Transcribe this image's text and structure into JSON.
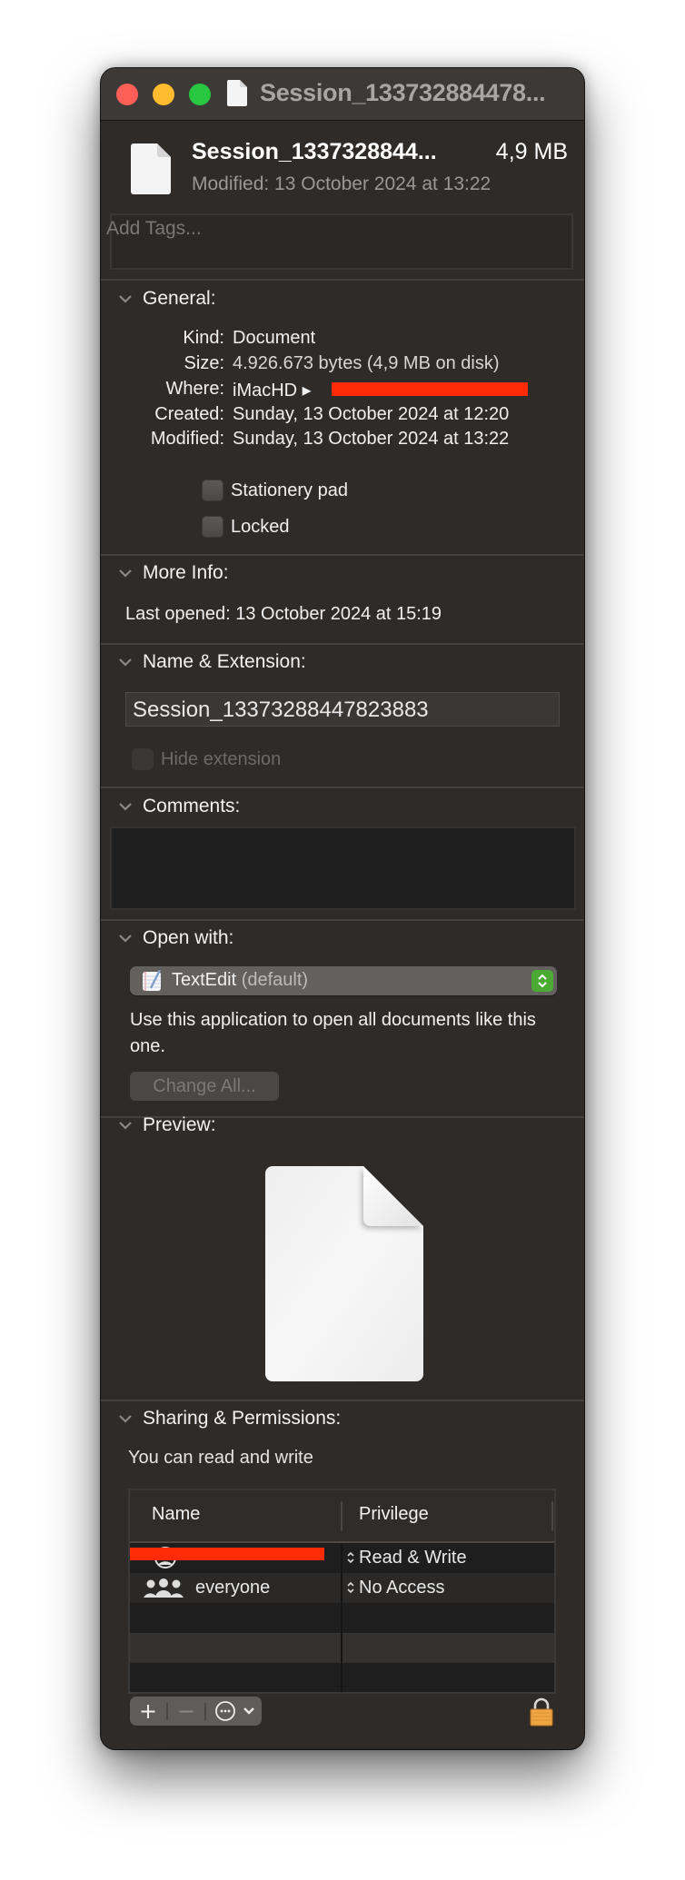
{
  "window": {
    "title": "Session_133732884478...",
    "traffic_lights": {
      "close": "#fe5f57",
      "minimize": "#febc2e",
      "zoom": "#28c840"
    }
  },
  "header": {
    "file_name": "Session_1337328844...",
    "file_size": "4,9 MB",
    "modified": "Modified: 13 October 2024 at 13:22",
    "icon": "document-icon"
  },
  "tags": {
    "placeholder": "Add Tags..."
  },
  "general": {
    "title": "General:",
    "rows": [
      {
        "label": "Kind:",
        "value": "Document"
      },
      {
        "label": "Size:",
        "value": "4.926.673 bytes (4,9 MB on disk)"
      },
      {
        "label": "Where:",
        "value": "iMacHD ▸ ",
        "redacted": true
      },
      {
        "label": "Created:",
        "value": "Sunday, 13 October 2024 at 12:20"
      },
      {
        "label": "Modified:",
        "value": "Sunday, 13 October 2024 at 13:22"
      }
    ],
    "checkboxes": [
      {
        "label": "Stationery pad",
        "checked": false
      },
      {
        "label": "Locked",
        "checked": false
      }
    ]
  },
  "more_info": {
    "title": "More Info:",
    "last_opened": "Last opened: 13 October 2024 at 15:19"
  },
  "name_extension": {
    "title": "Name & Extension:",
    "name_value": "Session_13373288447823883",
    "hide_extension_label": "Hide extension",
    "hide_extension_checked": false,
    "hide_extension_enabled": false
  },
  "comments": {
    "title": "Comments:",
    "value": ""
  },
  "open_with": {
    "title": "Open with:",
    "app": "TextEdit",
    "app_suffix": "(default)",
    "app_icon": "textedit-icon",
    "description": "Use this application to open all documents like this one.",
    "change_all_label": "Change All...",
    "change_all_enabled": false,
    "stepper_color": "#4aaa33"
  },
  "preview": {
    "title": "Preview:",
    "icon": "document-icon"
  },
  "sharing": {
    "title": "Sharing & Permissions:",
    "summary": "You can read and write",
    "columns": [
      "Name",
      "Privilege"
    ],
    "rows": [
      {
        "name": "",
        "name_redacted": true,
        "icon": "user-icon",
        "privilege": "Read & Write"
      },
      {
        "name": "everyone",
        "icon": "group-icon",
        "privilege": "No Access"
      }
    ],
    "toolbar": {
      "add": "add-icon",
      "remove": "remove-icon",
      "action": "action-menu-icon"
    },
    "lock": "lock-icon"
  },
  "colors": {
    "redaction": "#ff2a06",
    "window_bg": "#2f2b29",
    "titlebar_bg": "#3d3936"
  }
}
